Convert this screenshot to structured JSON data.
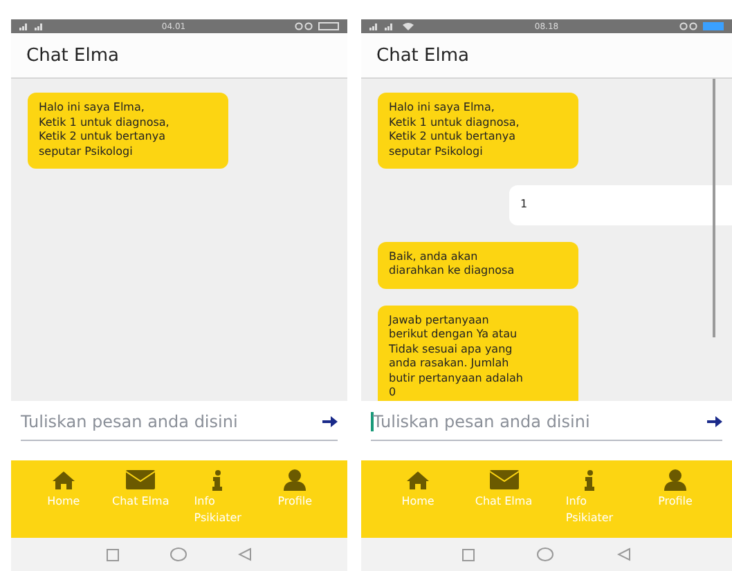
{
  "screens": [
    {
      "status_bar": {
        "time": "04.01",
        "wifi": false,
        "battery_charging": false
      },
      "title": "Chat Elma",
      "scrollbar": false,
      "messages": [
        {
          "kind": "bot",
          "text": "Halo ini saya Elma,\nKetik 1 untuk diagnosa,\nKetik 2 untuk bertanya\nseputar Psikologi"
        }
      ],
      "input": {
        "placeholder": "Tuliskan pesan anda disini",
        "focused": false
      },
      "nav": [
        {
          "label": "Home"
        },
        {
          "label": "Chat Elma"
        },
        {
          "label": "Info\nPsikiater"
        },
        {
          "label": "Profile"
        }
      ]
    },
    {
      "status_bar": {
        "time": "08.18",
        "wifi": true,
        "battery_charging": true
      },
      "title": "Chat Elma",
      "scrollbar": true,
      "messages": [
        {
          "kind": "bot",
          "text": "Halo ini saya Elma,\nKetik 1 untuk diagnosa,\nKetik 2 untuk bertanya\nseputar Psikologi"
        },
        {
          "kind": "user",
          "text": "1"
        },
        {
          "kind": "bot",
          "text": "Baik, anda akan\ndiarahkan ke diagnosa"
        },
        {
          "kind": "bot",
          "text": "Jawab pertanyaan\nberikut dengan Ya atau\nTidak sesuai apa yang\nanda rasakan. Jumlah\nbutir pertanyaan adalah\n0"
        }
      ],
      "input": {
        "placeholder": "Tuliskan pesan anda disini",
        "focused": true
      },
      "nav": [
        {
          "label": "Home"
        },
        {
          "label": "Chat Elma"
        },
        {
          "label": "Info\nPsikiater"
        },
        {
          "label": "Profile"
        }
      ]
    }
  ]
}
